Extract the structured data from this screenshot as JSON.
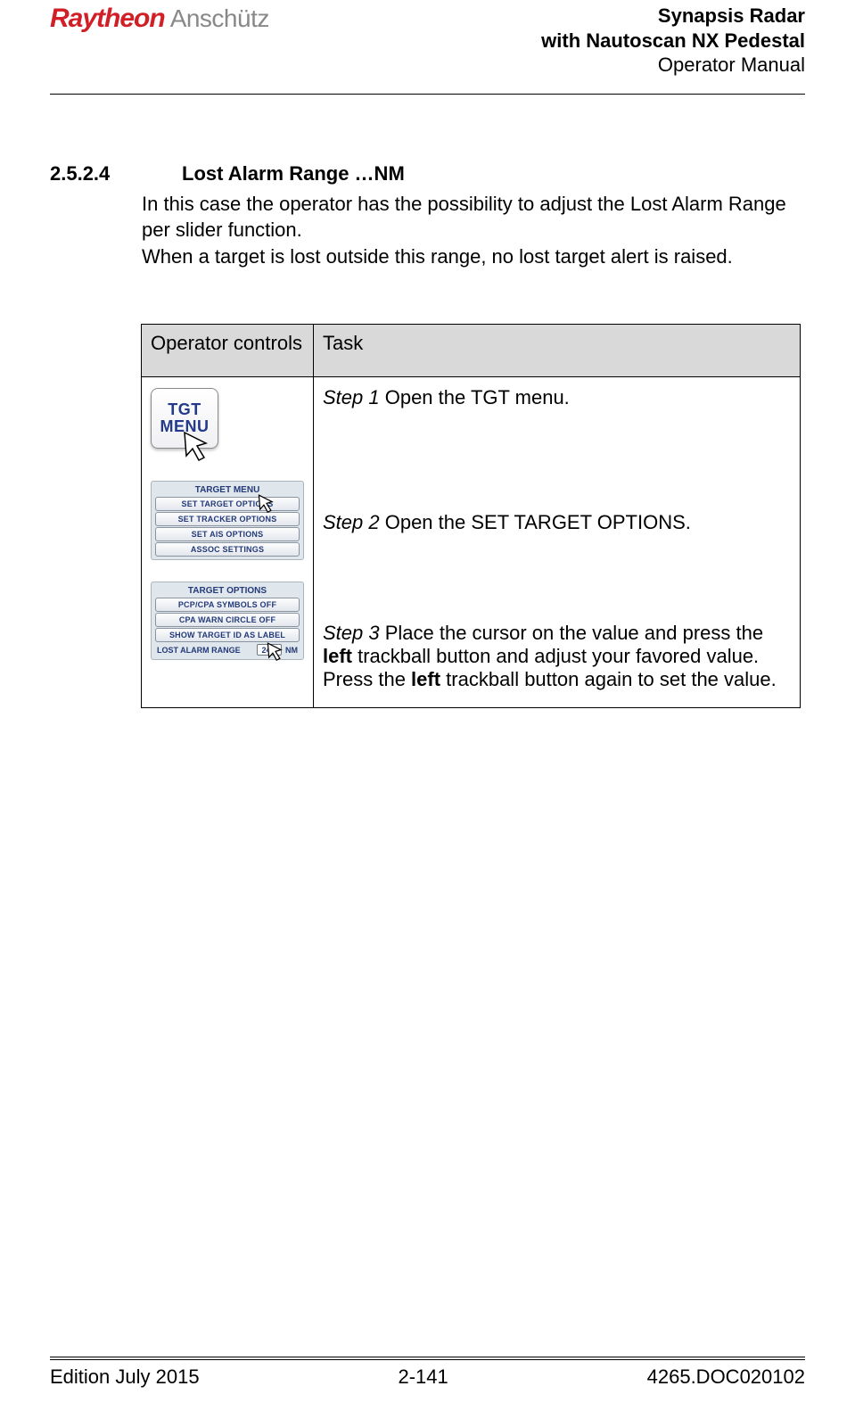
{
  "header": {
    "logo_part1": "Raytheon",
    "logo_part2": "Anschütz",
    "title_line1": "Synapsis Radar",
    "title_line2": "with Nautoscan NX Pedestal",
    "title_line3": "Operator Manual"
  },
  "section": {
    "number": "2.5.2.4",
    "title": "Lost Alarm Range …NM",
    "body_p1": "In this case the operator has the possibility to adjust the Lost Alarm Range per slider function.",
    "body_p2": "When a target is lost outside this range, no lost target alert is raised."
  },
  "table": {
    "head_left": "Operator controls",
    "head_right": "Task",
    "tgt_button": {
      "line1": "TGT",
      "line2": "MENU"
    },
    "target_menu": {
      "title": "TARGET MENU",
      "items": [
        "SET TARGET OPTIONS",
        "SET TRACKER OPTIONS",
        "SET AIS OPTIONS",
        "ASSOC SETTINGS"
      ]
    },
    "target_options": {
      "title": "TARGET OPTIONS",
      "items": [
        "PCP/CPA SYMBOLS OFF",
        "CPA WARN CIRCLE OFF",
        "SHOW TARGET ID AS LABEL"
      ],
      "range_row": {
        "label": "LOST ALARM RANGE",
        "value": "24.0",
        "unit": "NM"
      }
    },
    "steps": {
      "s1_label": "Step 1",
      "s1_text": " Open the TGT menu.",
      "s2_label": "Step 2",
      "s2_text": " Open the SET TARGET OPTIONS.",
      "s3_label": "Step 3",
      "s3_pre": " Place the cursor on the value and press the ",
      "s3_bold1": "left",
      "s3_mid": " trackball button and adjust your favored value. Press the ",
      "s3_bold2": "left",
      "s3_post": " trackball button again to set the value."
    }
  },
  "footer": {
    "left": "Edition July 2015",
    "center": "2-141",
    "right": "4265.DOC020102"
  }
}
